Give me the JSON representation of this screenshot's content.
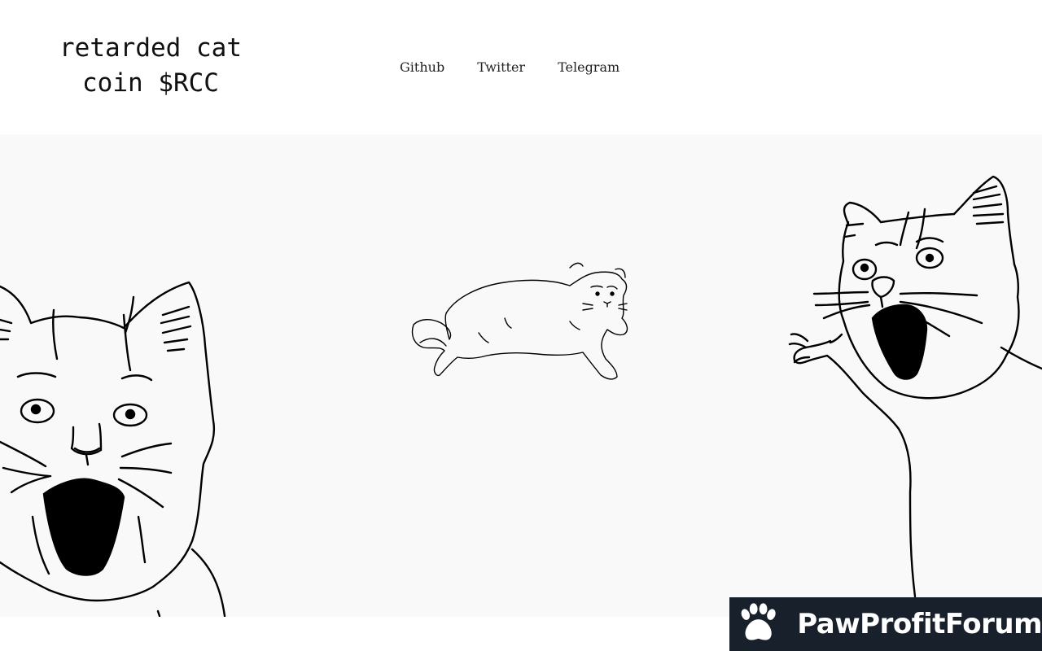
{
  "header": {
    "title_line1": "retarded cat",
    "title_line2": "coin $RCC",
    "nav": [
      "Github",
      "Twitter",
      "Telegram"
    ]
  },
  "hero": {
    "background": "#f9f9f9",
    "illustrations": [
      "screaming-cat-left",
      "lying-cat-center",
      "screaming-cat-right"
    ]
  },
  "badge": {
    "text": "PawProfitForum",
    "background": "#17202b",
    "icon": "paw-icon"
  }
}
